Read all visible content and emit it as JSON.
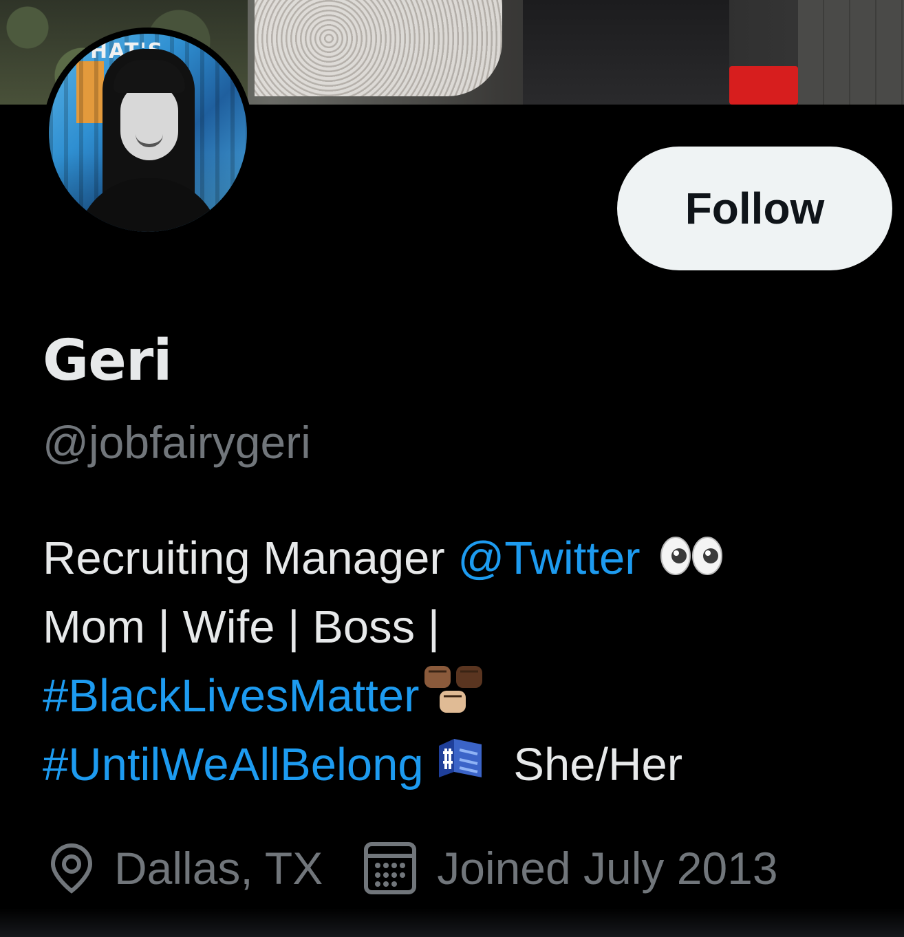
{
  "profile": {
    "display_name": "Geri",
    "handle": "@jobfairygeri",
    "follow_label": "Follow",
    "avatar_sign_text": "HAT'S"
  },
  "bio": {
    "line1_text": "Recruiting Manager ",
    "line1_mention": "@Twitter",
    "line1_emoji": "eyes-emoji",
    "line2_text": "Mom | Wife | Boss |",
    "line3_hashtag": "#BlackLivesMatter",
    "line3_emoji": "raised-fists-emoji",
    "line4_hashtag": "#UntilWeAllBelong",
    "line4_emoji": "hashtag-blocks-emoji",
    "line4_text": "She/Her"
  },
  "meta": {
    "location": "Dallas, TX",
    "location_icon": "location-pin-icon",
    "joined": "Joined July 2013",
    "joined_icon": "calendar-icon"
  },
  "colors": {
    "background": "#000000",
    "text_primary": "#e7e9ea",
    "text_secondary": "#71767b",
    "link": "#1d9bf0",
    "follow_bg": "#eff3f4",
    "follow_text": "#0f1419"
  }
}
